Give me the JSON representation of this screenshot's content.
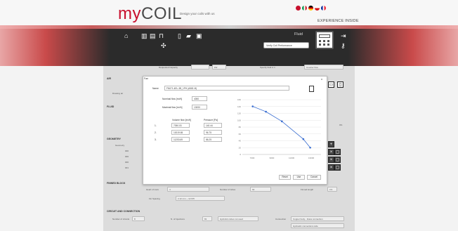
{
  "header": {
    "logo_prefix": "my",
    "logo_main": "COIL",
    "tagline": "Design your coils with us",
    "experience": "EXPERIENCE INSIDE",
    "flags": [
      "#c8102e",
      "#1e3a8a",
      "#000000",
      "#d52b1e",
      "#b30000"
    ]
  },
  "toolbar": {
    "fluid_label": "Fluid",
    "fluid_select": "Verify Coil Performance",
    "icons": [
      "home-icon",
      "grid-icon",
      "list-icon",
      "bed-icon",
      "file-icon",
      "folder-icon",
      "save-icon",
      "fan-icon",
      "logout-icon",
      "key-icon",
      "calculator-icon"
    ]
  },
  "main": {
    "required_capacity": "Requested Capacity",
    "capacity_unit": "kW",
    "specify_fluid": "Specify fluid in 1",
    "counter_flow": "Counter flow",
    "sections": [
      "AIR",
      "FLUID",
      "GEOMETRY",
      "FINNED BLOCK",
      "CIRCUIT AND CONNECTION"
    ],
    "air_side_label": "Drawing air",
    "geometry_label": "Geometry",
    "geometry_rows": [
      "000",
      "000",
      "000",
      "001"
    ],
    "percent_val": "0%",
    "finned": {
      "rows_label": "Heart of rows",
      "rows_value": "4",
      "tubes_label": "Number of tubes",
      "tubes_value": "64",
      "finned_length_label": "Finned length",
      "finned_length_value": "0.9",
      "fin_spacing_label": "Fin Spacing",
      "fin_spacing_value": "2.12 mm ~ 12 FPI"
    },
    "circuit": {
      "circuits_label": "Number of circuits",
      "circuits_value": "8",
      "injections_label": "N. of Injections",
      "injections_value": "81",
      "hydrauli_label": "Hydrolics tubes not used",
      "connection_label": "Connection",
      "connection_value": "Copper body - brass connection",
      "connections_side": "Hydraulic connections side"
    }
  },
  "modal": {
    "title": "Fan",
    "close": "x",
    "name_label": "Name",
    "name_value": "FN071-4EL-3B_1PH (A581 M)",
    "nominal_flow_label": "Nominal flow [m³/h]",
    "nominal_flow_value": "4050",
    "maximal_flow_label": "Maximal flow [m³/h]",
    "maximal_flow_value": "13000",
    "table_headers": [
      "Volume flow [m³/h]",
      "Pressure [Pa]"
    ],
    "table_rows": [
      {
        "idx": "1.",
        "flow": "7050.03",
        "pressure": "140.44"
      },
      {
        "idx": "2.",
        "flow": "10019.65",
        "pressure": "96.75"
      },
      {
        "idx": "3.",
        "flow": "11253.69",
        "pressure": "86.25"
      }
    ],
    "buttons": {
      "reset": "Reset",
      "use": "Use",
      "cancel": "Cancel"
    }
  },
  "chart_data": {
    "type": "line",
    "x": [
      7050.03,
      8400,
      10019.65,
      12200,
      12900
    ],
    "y": [
      140.44,
      125,
      96.75,
      45,
      20
    ],
    "xlim": [
      6000,
      14000
    ],
    "ylim": [
      0,
      160
    ],
    "y_ticks": [
      "160",
      "140",
      "120",
      "100",
      "80",
      "60",
      "40",
      "20",
      "0"
    ],
    "x_ticks": [
      "7000",
      "9000",
      "11000",
      "13000"
    ],
    "grid": true,
    "line_color": "#3b6fd1"
  }
}
